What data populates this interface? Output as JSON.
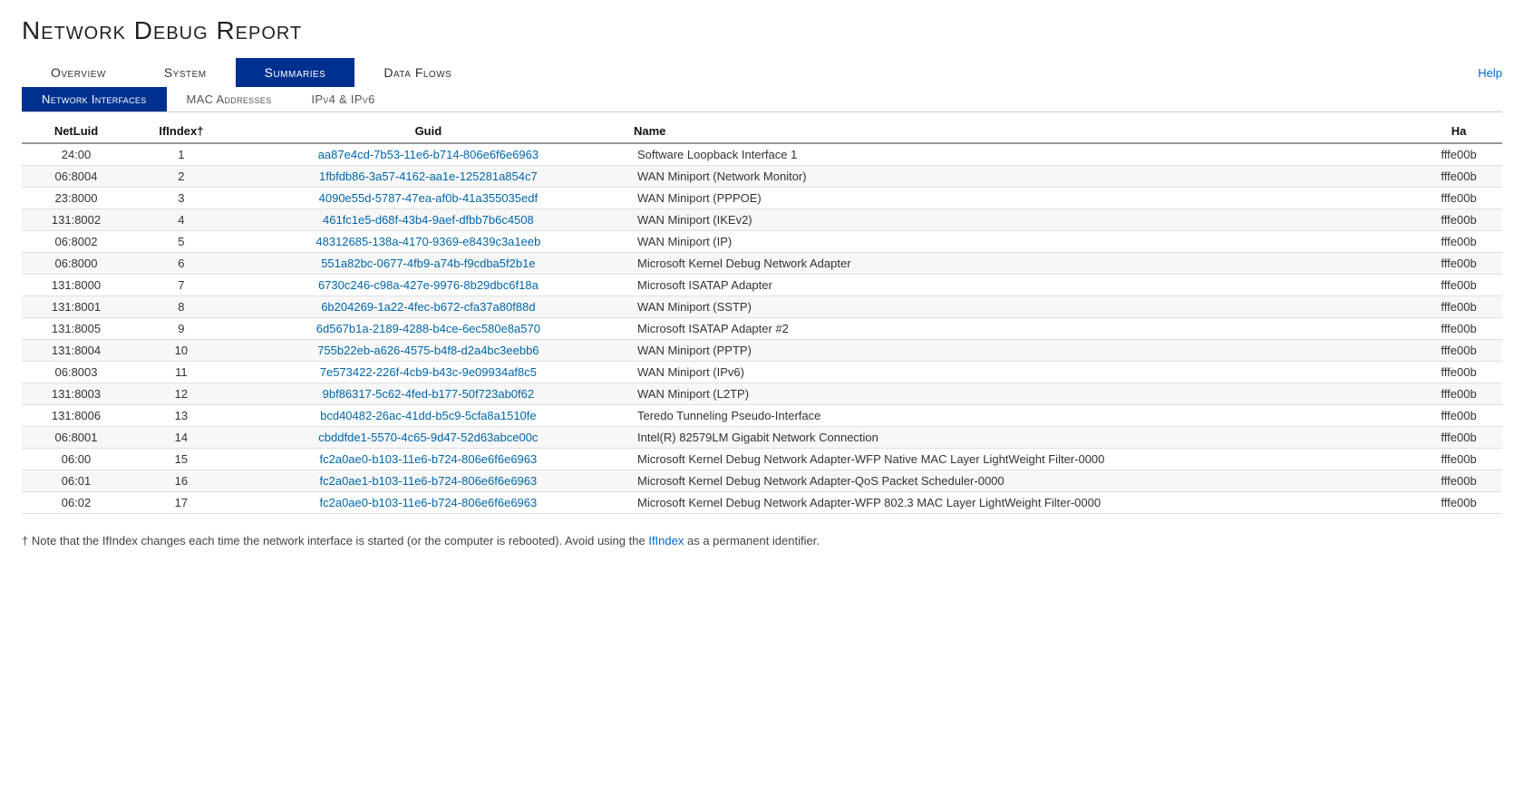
{
  "page": {
    "title": "Network Debug Report",
    "help_label": "Help"
  },
  "top_nav": {
    "items": [
      {
        "label": "Overview",
        "active": false
      },
      {
        "label": "System",
        "active": false
      },
      {
        "label": "Summaries",
        "active": true
      },
      {
        "label": "Data Flows",
        "active": false
      }
    ]
  },
  "sub_nav": {
    "items": [
      {
        "label": "Network Interfaces",
        "active": true
      },
      {
        "label": "MAC Addresses",
        "active": false
      },
      {
        "label": "IPv4 & IPv6",
        "active": false
      }
    ]
  },
  "table": {
    "columns": [
      "NetLuid",
      "IfIndex†",
      "Guid",
      "Name",
      "Ha"
    ],
    "rows": [
      {
        "netluid": "24:00",
        "ifindex": "1",
        "guid": "aa87e4cd-7b53-11e6-b714-806e6f6e6963",
        "name": "Software Loopback Interface 1",
        "ha": "fffe00b"
      },
      {
        "netluid": "06:8004",
        "ifindex": "2",
        "guid": "1fbfdb86-3a57-4162-aa1e-125281a854c7",
        "name": "WAN Miniport (Network Monitor)",
        "ha": "fffe00b"
      },
      {
        "netluid": "23:8000",
        "ifindex": "3",
        "guid": "4090e55d-5787-47ea-af0b-41a355035edf",
        "name": "WAN Miniport (PPPOE)",
        "ha": "fffe00b"
      },
      {
        "netluid": "131:8002",
        "ifindex": "4",
        "guid": "461fc1e5-d68f-43b4-9aef-dfbb7b6c4508",
        "name": "WAN Miniport (IKEv2)",
        "ha": "fffe00b"
      },
      {
        "netluid": "06:8002",
        "ifindex": "5",
        "guid": "48312685-138a-4170-9369-e8439c3a1eeb",
        "name": "WAN Miniport (IP)",
        "ha": "fffe00b"
      },
      {
        "netluid": "06:8000",
        "ifindex": "6",
        "guid": "551a82bc-0677-4fb9-a74b-f9cdba5f2b1e",
        "name": "Microsoft Kernel Debug Network Adapter",
        "ha": "fffe00b"
      },
      {
        "netluid": "131:8000",
        "ifindex": "7",
        "guid": "6730c246-c98a-427e-9976-8b29dbc6f18a",
        "name": "Microsoft ISATAP Adapter",
        "ha": "fffe00b"
      },
      {
        "netluid": "131:8001",
        "ifindex": "8",
        "guid": "6b204269-1a22-4fec-b672-cfa37a80f88d",
        "name": "WAN Miniport (SSTP)",
        "ha": "fffe00b"
      },
      {
        "netluid": "131:8005",
        "ifindex": "9",
        "guid": "6d567b1a-2189-4288-b4ce-6ec580e8a570",
        "name": "Microsoft ISATAP Adapter #2",
        "ha": "fffe00b"
      },
      {
        "netluid": "131:8004",
        "ifindex": "10",
        "guid": "755b22eb-a626-4575-b4f8-d2a4bc3eebb6",
        "name": "WAN Miniport (PPTP)",
        "ha": "fffe00b"
      },
      {
        "netluid": "06:8003",
        "ifindex": "11",
        "guid": "7e573422-226f-4cb9-b43c-9e09934af8c5",
        "name": "WAN Miniport (IPv6)",
        "ha": "fffe00b"
      },
      {
        "netluid": "131:8003",
        "ifindex": "12",
        "guid": "9bf86317-5c62-4fed-b177-50f723ab0f62",
        "name": "WAN Miniport (L2TP)",
        "ha": "fffe00b"
      },
      {
        "netluid": "131:8006",
        "ifindex": "13",
        "guid": "bcd40482-26ac-41dd-b5c9-5cfa8a1510fe",
        "name": "Teredo Tunneling Pseudo-Interface",
        "ha": "fffe00b"
      },
      {
        "netluid": "06:8001",
        "ifindex": "14",
        "guid": "cbddfde1-5570-4c65-9d47-52d63abce00c",
        "name": "Intel(R) 82579LM Gigabit Network Connection",
        "ha": "fffe00b"
      },
      {
        "netluid": "06:00",
        "ifindex": "15",
        "guid": "fc2a0ae0-b103-11e6-b724-806e6f6e6963",
        "name": "Microsoft Kernel Debug Network Adapter-WFP Native MAC Layer LightWeight Filter-0000",
        "ha": "fffe00b"
      },
      {
        "netluid": "06:01",
        "ifindex": "16",
        "guid": "fc2a0ae1-b103-11e6-b724-806e6f6e6963",
        "name": "Microsoft Kernel Debug Network Adapter-QoS Packet Scheduler-0000",
        "ha": "fffe00b"
      },
      {
        "netluid": "06:02",
        "ifindex": "17",
        "guid": "fc2a0ae0-b103-11e6-b724-806e6f6e6963",
        "name": "Microsoft Kernel Debug Network Adapter-WFP 802.3 MAC Layer LightWeight Filter-0000",
        "ha": "fffe00b"
      }
    ]
  },
  "footnote": {
    "text": "† Note that the IfIndex changes each time the network interface is started (or the computer is rebooted). Avoid using the IfIndex as a permanent identifier.",
    "link_text": "IfIndex"
  }
}
